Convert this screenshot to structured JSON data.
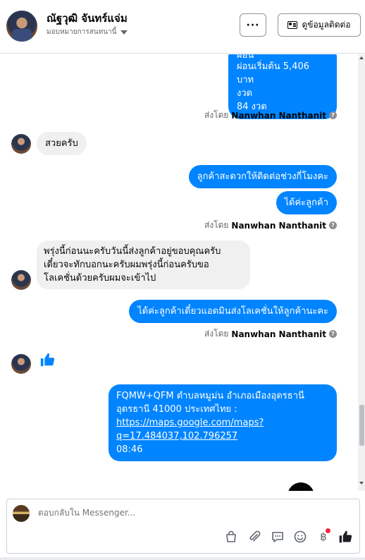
{
  "header": {
    "name": "ณัฐวุฒิ จันทร์แจ่ม",
    "subtitle": "มอบหมายการสนทนานี้",
    "more_label": "···",
    "contact_label": "ดูข้อมูลติดต่อ"
  },
  "messages": {
    "m1": {
      "line1": "ผ่อนเริ่มต้น 5,406 บาท",
      "line2": "งวด",
      "line3": "84 งวด",
      "partial": "ผ่อน"
    },
    "sent1": {
      "prefix": "ส่งโดย",
      "name": "Nanwhan Nanthanit"
    },
    "m2": {
      "text": "สวยครับ"
    },
    "m3": {
      "text": "ลูกค้าสะดวกให้ติดต่อช่วงกี่โมงคะ"
    },
    "m4": {
      "text": "ได้ค่ะลูกค้า"
    },
    "sent2": {
      "prefix": "ส่งโดย",
      "name": "Nanwhan Nanthanit"
    },
    "m5": {
      "line1": "พรุ่งนี้ก่อนนะครับวันนี้ส่งลูกค้าอยู่ขอบคุณครับ",
      "line2": "เดี๋ยวจะทักบอกนะครับผมพรุ่งนี้ก่อนครับขอ",
      "line3": "โลเคชั่นด้วยครับผมจะเข้าไป"
    },
    "m6": {
      "text": "ได้ค่ะลูกค้าเดี๋ยวแอดมินส่งโลเคชั่นให้ลูกค้านะคะ"
    },
    "sent3": {
      "prefix": "ส่งโดย",
      "name": "Nanwhan Nanthanit"
    },
    "m8": {
      "line1": "FQMW+QFM ตำบลหมูม่น อำเภอเมืองอุดรธานี",
      "line2": "อุดรธานี 41000 ประเทศไทย :",
      "link1": "https://maps.google.com/maps?",
      "link2": "q=17.484037,102.796257",
      "time": "08:46"
    }
  },
  "composer": {
    "placeholder": "ตอบกลับใน Messenger..."
  },
  "icons": {
    "tool1": "bag-icon",
    "tool2": "attachment-icon",
    "tool3": "saved-reply-icon",
    "tool4": "emoji-icon",
    "tool5": "baht-payment-icon",
    "tool6": "thumbs-up-icon"
  },
  "baht_symbol": "฿",
  "colors": {
    "accent": "#0084ff",
    "incoming": "#f0f0f0",
    "notify": "#f02849"
  }
}
